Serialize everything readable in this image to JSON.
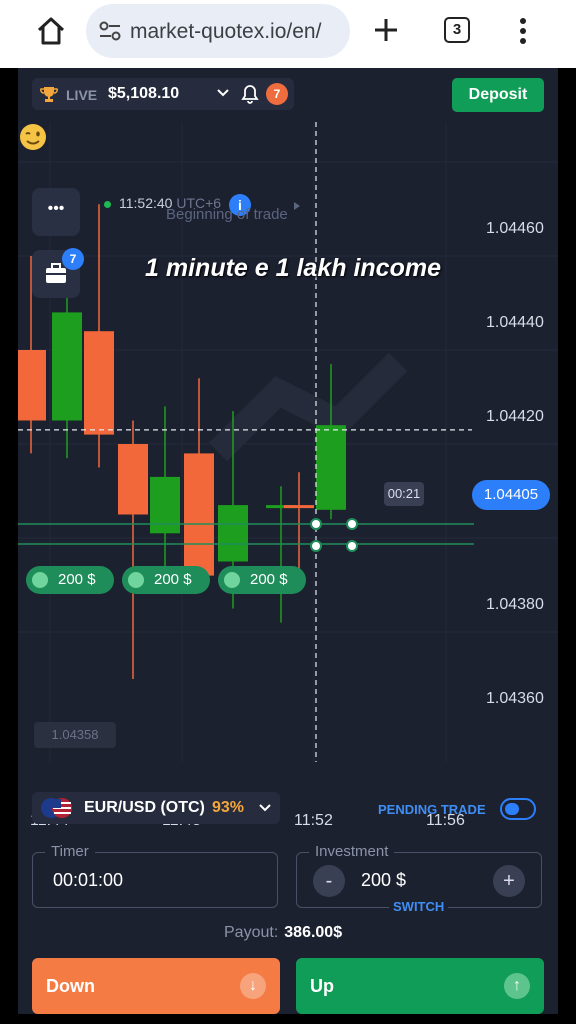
{
  "browser": {
    "url": "market-quotex.io/en/",
    "tab_count": "3"
  },
  "topbar": {
    "account_mode": "LIVE",
    "balance": "$5,108.10",
    "notifications": "7",
    "deposit_label": "Deposit"
  },
  "chart_overlay": {
    "server_time": "11:52:40",
    "timezone": "UTC+6",
    "info": "i",
    "begin_label": "Beginning of trade",
    "caption": "1 minute e 1 lakh income",
    "briefcase_badge": "7",
    "dots": "•••",
    "countdown": "00:21",
    "ghost_price": "1.04358"
  },
  "colors": {
    "bullish": "#1e9e1e",
    "bearish": "#f2683a",
    "accent": "#2d7ff9",
    "background": "#1c2130"
  },
  "chart_data": {
    "type": "candlestick",
    "x_ticks": [
      "11:44",
      "11:48",
      "11:52",
      "11:56"
    ],
    "y_ticks": [
      "1.04460",
      "1.04440",
      "1.04420",
      "1.04380",
      "1.04360"
    ],
    "current_price": "1.04405",
    "candles": [
      {
        "open": 1.0442,
        "close": 1.04405,
        "high": 1.0444,
        "low": 1.04398,
        "dir": "down"
      },
      {
        "open": 1.04405,
        "close": 1.04428,
        "high": 1.04435,
        "low": 1.04397,
        "dir": "up"
      },
      {
        "open": 1.04424,
        "close": 1.04402,
        "high": 1.04451,
        "low": 1.04395,
        "dir": "down"
      },
      {
        "open": 1.044,
        "close": 1.04385,
        "high": 1.04405,
        "low": 1.0435,
        "dir": "down"
      },
      {
        "open": 1.04381,
        "close": 1.04393,
        "high": 1.04408,
        "low": 1.0437,
        "dir": "up"
      },
      {
        "open": 1.04398,
        "close": 1.04372,
        "high": 1.04414,
        "low": 1.04369,
        "dir": "down"
      },
      {
        "open": 1.04375,
        "close": 1.04387,
        "high": 1.04407,
        "low": 1.04365,
        "dir": "up"
      },
      {
        "open": 1.04387,
        "close": 1.04387,
        "high": 1.04391,
        "low": 1.04362,
        "dir": "up"
      },
      {
        "open": 1.04387,
        "close": 1.04387,
        "high": 1.04394,
        "low": 1.0437,
        "dir": "down"
      },
      {
        "open": 1.04386,
        "close": 1.04404,
        "high": 1.04417,
        "low": 1.04384,
        "dir": "up"
      }
    ],
    "trades": [
      {
        "amount": "200 $",
        "direction": "up"
      },
      {
        "amount": "200 $",
        "direction": "up"
      },
      {
        "amount": "200 $",
        "direction": "up"
      }
    ]
  },
  "trade_panel": {
    "pair": "EUR/USD (OTC)",
    "payout_percent": "93%",
    "pending_label": "PENDING TRADE",
    "timer_label": "Timer",
    "timer_value": "00:01:00",
    "investment_label": "Investment",
    "investment_value": "200 $",
    "minus": "-",
    "plus": "+",
    "switch_label": "SWITCH",
    "payout_label": "Payout:",
    "payout_value": "386.00$",
    "down_label": "Down",
    "up_label": "Up",
    "down_icon": "↓",
    "up_icon": "↑"
  }
}
